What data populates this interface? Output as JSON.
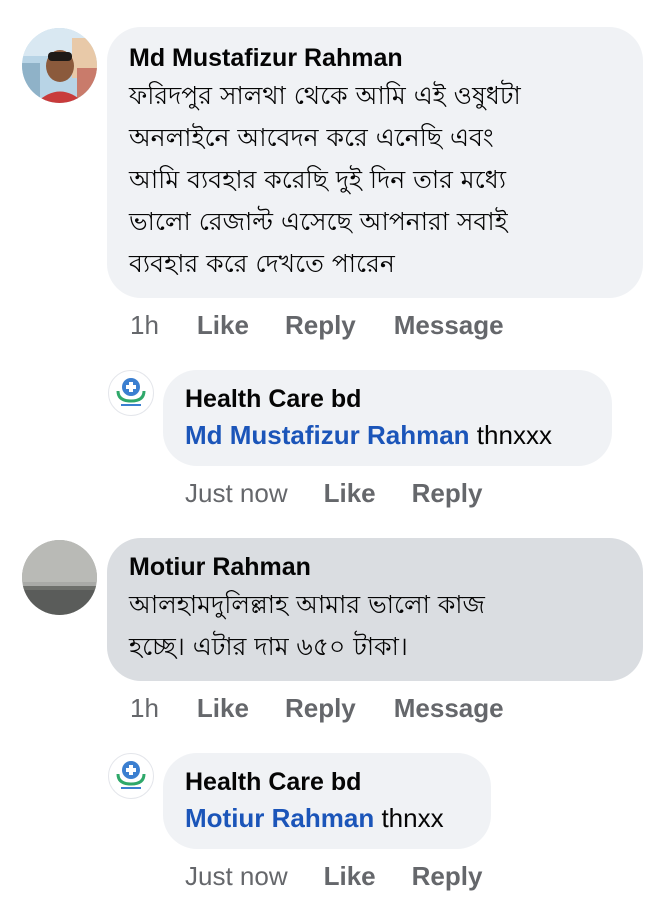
{
  "thread": [
    {
      "author": "Md Mustafizur Rahman",
      "lines": [
        "ফরিদপুর সালথা থেকে আমি এই ওষুধটা",
        "অনলাইনে আবেদন করে এনেছি এবং",
        "আমি ব্যবহার করেছি দুই দিন তার মধ্যে",
        "ভালো রেজাল্ট এসেছে আপনারা সবাই",
        "ব্যবহার করে  দেখতে পারেন"
      ],
      "time": "1h",
      "like": "Like",
      "reply": "Reply",
      "message": "Message",
      "avatar_icon": "user-photo-avatar",
      "reply_item": {
        "author": "Health Care bd",
        "mention": "Md Mustafizur Rahman",
        "text": " thnxxx",
        "time": "Just now",
        "like": "Like",
        "reply": "Reply",
        "avatar_icon": "health-care-logo"
      }
    },
    {
      "author": "Motiur Rahman",
      "lines": [
        "আলহামদুলিল্লাহ আমার ভালো কাজ",
        "হচ্ছে। এটার দাম ৬৫০ টাকা।"
      ],
      "time": "1h",
      "like": "Like",
      "reply": "Reply",
      "message": "Message",
      "avatar_icon": "landscape-photo-avatar",
      "reply_item": {
        "author": "Health Care bd",
        "mention": "Motiur Rahman",
        "text": " thnxx",
        "time": "Just now",
        "like": "Like",
        "reply": "Reply",
        "avatar_icon": "health-care-logo"
      }
    }
  ],
  "colors": {
    "bubble": "#f0f2f5",
    "bubble_pressed": "#dadde1",
    "mention": "#1b55b9",
    "meta": "#65676b"
  }
}
